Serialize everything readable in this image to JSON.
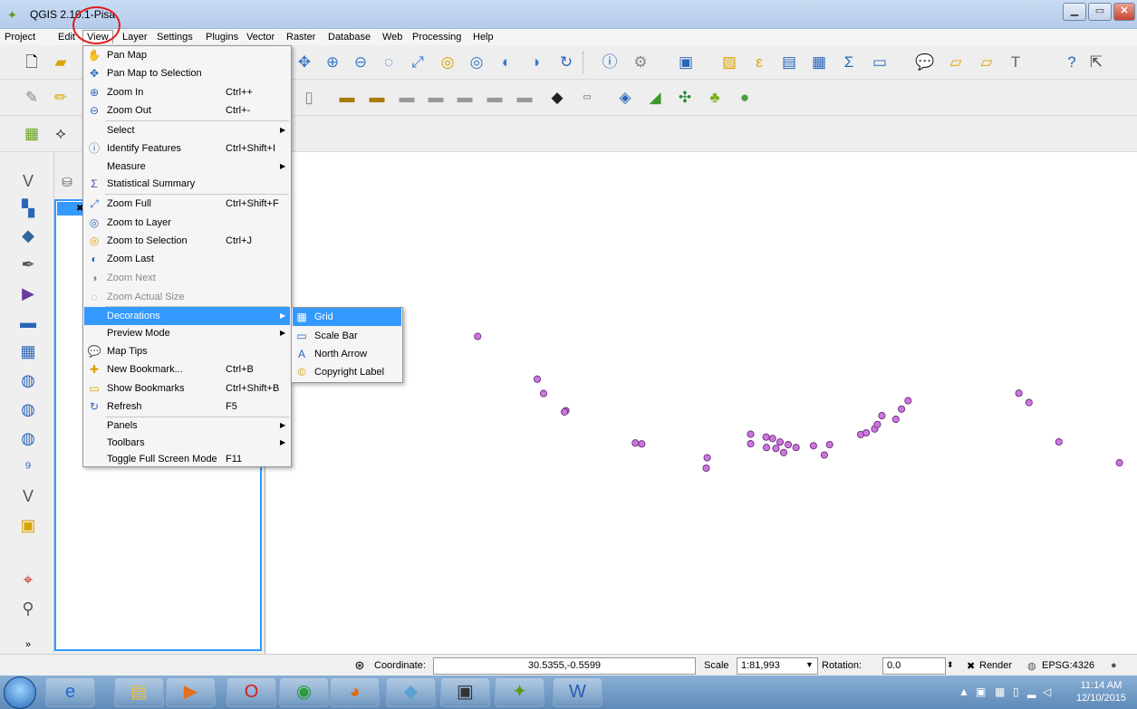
{
  "window": {
    "title": "QGIS 2.10.1-Pisa",
    "minimize": "▁",
    "maximize": "▭",
    "close": "✕"
  },
  "menubar": [
    "Project",
    "Edit",
    "View",
    "Layer",
    "Settings",
    "Plugins",
    "Vector",
    "Raster",
    "Database",
    "Web",
    "Processing",
    "Help"
  ],
  "view_menu": {
    "items": [
      {
        "label": "Pan Map",
        "shortcut": "",
        "icon": "✋",
        "icon_name": "pan-map-icon"
      },
      {
        "label": "Pan Map to Selection",
        "shortcut": "",
        "icon": "✥",
        "icon_name": "pan-to-selection-icon"
      },
      {
        "label": "Zoom In",
        "shortcut": "Ctrl++",
        "icon": "⊕",
        "icon_name": "zoom-in-icon"
      },
      {
        "label": "Zoom Out",
        "shortcut": "Ctrl+-",
        "icon": "⊖",
        "icon_name": "zoom-out-icon"
      },
      {
        "label": "Select",
        "shortcut": "",
        "icon": "",
        "icon_name": ""
      },
      {
        "label": "Identify Features",
        "shortcut": "Ctrl+Shift+I",
        "icon": "ⓘ",
        "icon_name": "identify-icon"
      },
      {
        "label": "Measure",
        "shortcut": "",
        "icon": "",
        "icon_name": ""
      },
      {
        "label": "Statistical Summary",
        "shortcut": "",
        "icon": "Σ",
        "icon_name": "sigma-icon"
      },
      {
        "label": "Zoom Full",
        "shortcut": "Ctrl+Shift+F",
        "icon": "⤢",
        "icon_name": "zoom-full-icon"
      },
      {
        "label": "Zoom to Layer",
        "shortcut": "",
        "icon": "◎",
        "icon_name": "zoom-layer-icon"
      },
      {
        "label": "Zoom to Selection",
        "shortcut": "Ctrl+J",
        "icon": "◎",
        "icon_name": "zoom-selection-icon"
      },
      {
        "label": "Zoom Last",
        "shortcut": "",
        "icon": "◐",
        "icon_name": "zoom-last-icon"
      },
      {
        "label": "Zoom Next",
        "shortcut": "",
        "icon": "◑",
        "icon_name": "zoom-next-icon"
      },
      {
        "label": "Zoom Actual Size",
        "shortcut": "",
        "icon": "◌",
        "icon_name": "zoom-actual-icon"
      },
      {
        "label": "Decorations",
        "shortcut": "",
        "icon": "",
        "icon_name": ""
      },
      {
        "label": "Preview Mode",
        "shortcut": "",
        "icon": "",
        "icon_name": ""
      },
      {
        "label": "Map Tips",
        "shortcut": "",
        "icon": "💬",
        "icon_name": "map-tips-icon"
      },
      {
        "label": "New Bookmark...",
        "shortcut": "Ctrl+B",
        "icon": "✚",
        "icon_name": "new-bookmark-icon"
      },
      {
        "label": "Show Bookmarks",
        "shortcut": "Ctrl+Shift+B",
        "icon": "▭",
        "icon_name": "bookmarks-icon"
      },
      {
        "label": "Refresh",
        "shortcut": "F5",
        "icon": "↻",
        "icon_name": "refresh-icon"
      },
      {
        "label": "Panels",
        "shortcut": "",
        "icon": "",
        "icon_name": ""
      },
      {
        "label": "Toolbars",
        "shortcut": "",
        "icon": "",
        "icon_name": ""
      },
      {
        "label": "Toggle Full Screen Mode",
        "shortcut": "F11",
        "icon": "",
        "icon_name": ""
      }
    ],
    "submenu_arrow": "▶"
  },
  "decorations_menu": {
    "items": [
      {
        "label": "Grid",
        "icon": "▦",
        "icon_name": "grid-icon"
      },
      {
        "label": "Scale Bar",
        "icon": "▭",
        "icon_name": "scale-bar-icon"
      },
      {
        "label": "North Arrow",
        "icon": "A",
        "icon_name": "north-arrow-icon"
      },
      {
        "label": "Copyright Label",
        "icon": "©",
        "icon_name": "copyright-icon"
      }
    ]
  },
  "statusbar": {
    "coordinate_label": "Coordinate:",
    "coordinate_value": "30.5355,-0.5599",
    "scale_label": "Scale",
    "scale_value": "1:81,993",
    "rotation_label": "Rotation:",
    "rotation_value": "0.0",
    "render_label": "Render",
    "crs_label": "EPSG:4326"
  },
  "taskbar": {
    "time": "11:14 AM",
    "date": "12/10/2015"
  },
  "colors": {
    "point_fill": "#cc77dd",
    "point_stroke": "#6a2a7a",
    "highlight": "#3399ff",
    "annotation": "#e02020"
  },
  "map_points": [
    [
      0.2432,
      0.3673
    ],
    [
      0.3115,
      0.4525
    ],
    [
      0.3188,
      0.4812
    ],
    [
      0.3443,
      0.5154
    ],
    [
      0.3428,
      0.5178
    ],
    [
      0.4313,
      0.5816
    ],
    [
      0.424,
      0.5798
    ],
    [
      0.5063,
      0.6092
    ],
    [
      0.5052,
      0.63
    ],
    [
      0.5561,
      0.5622
    ],
    [
      0.5561,
      0.5814
    ],
    [
      0.5742,
      0.5888
    ],
    [
      0.5852,
      0.5906
    ],
    [
      0.5898,
      0.578
    ],
    [
      0.5992,
      0.5833
    ],
    [
      0.6082,
      0.5888
    ],
    [
      0.6281,
      0.5853
    ],
    [
      0.6406,
      0.6038
    ],
    [
      0.6466,
      0.5833
    ],
    [
      0.6822,
      0.563
    ],
    [
      0.6886,
      0.5596
    ],
    [
      0.6982,
      0.552
    ],
    [
      0.7013,
      0.543
    ],
    [
      0.7065,
      0.5254
    ],
    [
      0.7225,
      0.5326
    ],
    [
      0.7291,
      0.5122
    ],
    [
      0.7366,
      0.4956
    ],
    [
      0.8636,
      0.4805
    ],
    [
      0.8752,
      0.4992
    ],
    [
      0.9095,
      0.5776
    ],
    [
      0.9788,
      0.6193
    ],
    [
      0.5738,
      0.568
    ],
    [
      0.5812,
      0.571
    ],
    [
      0.594,
      0.599
    ]
  ]
}
